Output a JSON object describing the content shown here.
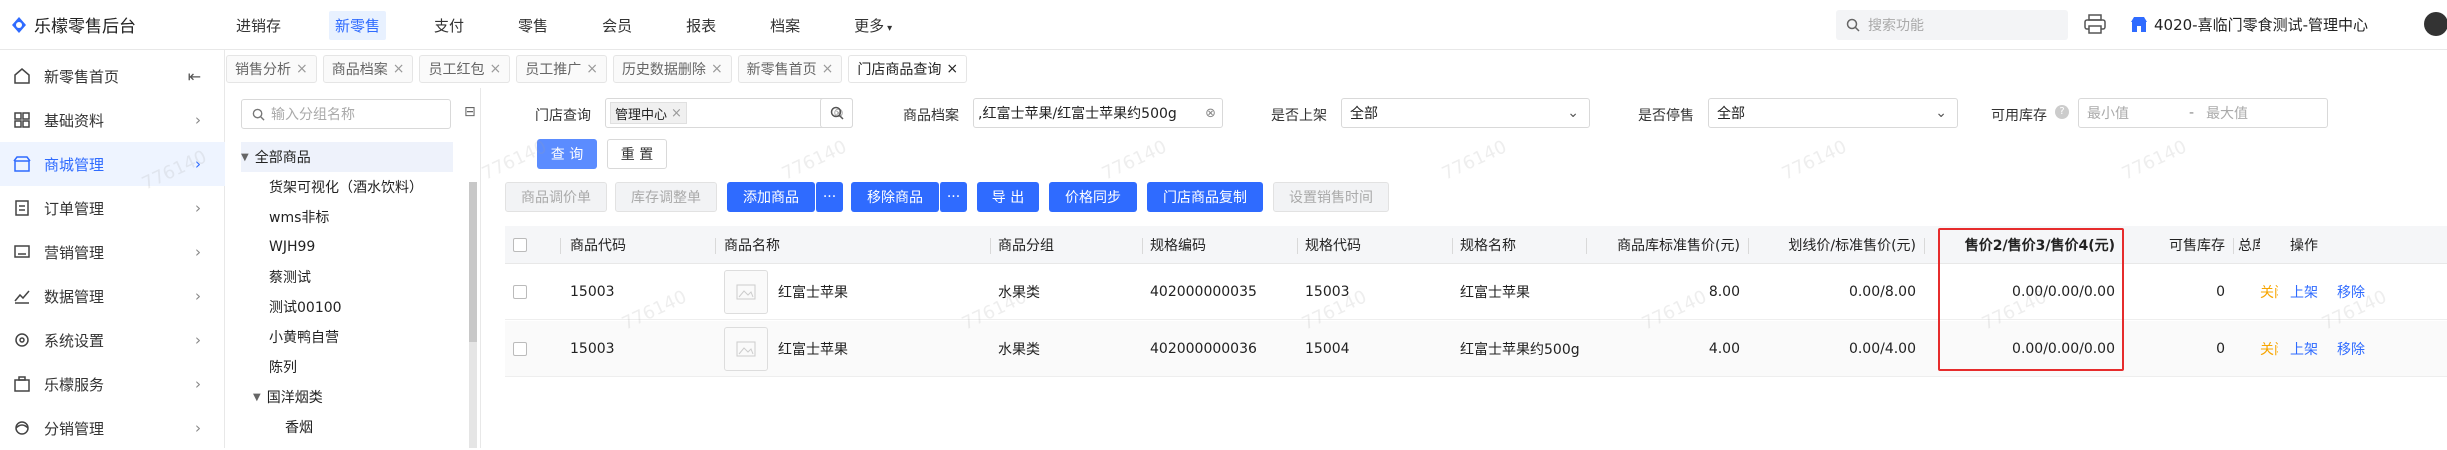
{
  "app": {
    "title": "乐檬零售后台"
  },
  "topnav": [
    "进销存",
    "新零售",
    "支付",
    "零售",
    "会员",
    "报表",
    "档案",
    "更多"
  ],
  "topnav_active_index": 1,
  "search": {
    "placeholder": "搜索功能"
  },
  "store": {
    "name": "4020-喜临门零食测试-管理中心"
  },
  "sidebar": [
    {
      "label": "新零售首页",
      "icon": "home-icon"
    },
    {
      "label": "基础资料",
      "icon": "grid-icon"
    },
    {
      "label": "商城管理",
      "icon": "store-icon"
    },
    {
      "label": "订单管理",
      "icon": "order-icon"
    },
    {
      "label": "营销管理",
      "icon": "marketing-icon"
    },
    {
      "label": "数据管理",
      "icon": "chart-icon"
    },
    {
      "label": "系统设置",
      "icon": "settings-icon"
    },
    {
      "label": "乐檬服务",
      "icon": "briefcase-icon"
    },
    {
      "label": "分销管理",
      "icon": "distribution-icon"
    }
  ],
  "sidebar_active_index": 2,
  "tabs": [
    "销售分析",
    "商品档案",
    "员工红包",
    "员工推广",
    "历史数据删除",
    "新零售首页",
    "门店商品查询"
  ],
  "tabs_active_index": 6,
  "tree": {
    "search_placeholder": "输入分组名称",
    "items": [
      "全部商品",
      "货架可视化（酒水饮料）",
      "wms非标",
      "WJH99",
      "蔡测试",
      "测试00100",
      "小黄鸭自营",
      "陈列",
      "国洋烟类",
      "香烟"
    ]
  },
  "filters": {
    "store_label": "门店查询",
    "store_chip": "管理中心",
    "product_label": "商品档案",
    "product_value": ",红富士苹果/红富士苹果约500g",
    "listed_label": "是否上架",
    "listed_value": "全部",
    "stop_label": "是否停售",
    "stop_value": "全部",
    "stock_label": "可用库存",
    "stock_min_placeholder": "最小值",
    "stock_max_placeholder": "最大值",
    "stock_range_sep": "-"
  },
  "buttons": {
    "query": "查 询",
    "reset": "重 置",
    "price_adjust": "商品调价单",
    "stock_adjust": "库存调整单",
    "add_product": "添加商品",
    "remove_product": "移除商品",
    "export": "导 出",
    "price_sync": "价格同步",
    "store_copy": "门店商品复制",
    "sale_time": "设置销售时间",
    "more": "···"
  },
  "table": {
    "headers": [
      "商品代码",
      "商品名称",
      "商品分组",
      "规格编码",
      "规格代码",
      "规格名称",
      "商品库标准售价(元)",
      "划线价/标准售价(元)",
      "售价2/售价3/售价4(元)",
      "可售库存",
      "总库",
      "操作"
    ],
    "rows": [
      {
        "code": "15003",
        "name": "红富士苹果",
        "group": "水果类",
        "spec_code": "402000000035",
        "spec_no": "15003",
        "spec_name": "红富士苹果",
        "std_price": "8.00",
        "line_price": "0.00/8.00",
        "prices": "0.00/0.00/0.00",
        "stock": "0",
        "total": "关闭",
        "action1": "上架",
        "action2": "移除"
      },
      {
        "code": "15003",
        "name": "红富士苹果",
        "group": "水果类",
        "spec_code": "402000000036",
        "spec_no": "15004",
        "spec_name": "红富士苹果约500g",
        "std_price": "4.00",
        "line_price": "0.00/4.00",
        "prices": "0.00/0.00/0.00",
        "stock": "0",
        "total": "关闭",
        "action1": "上架",
        "action2": "移除"
      }
    ]
  },
  "watermark": "776140",
  "colors": {
    "accent": "#2f6bff",
    "highlight_box": "#e62c2c",
    "warning": "#f7a500"
  }
}
